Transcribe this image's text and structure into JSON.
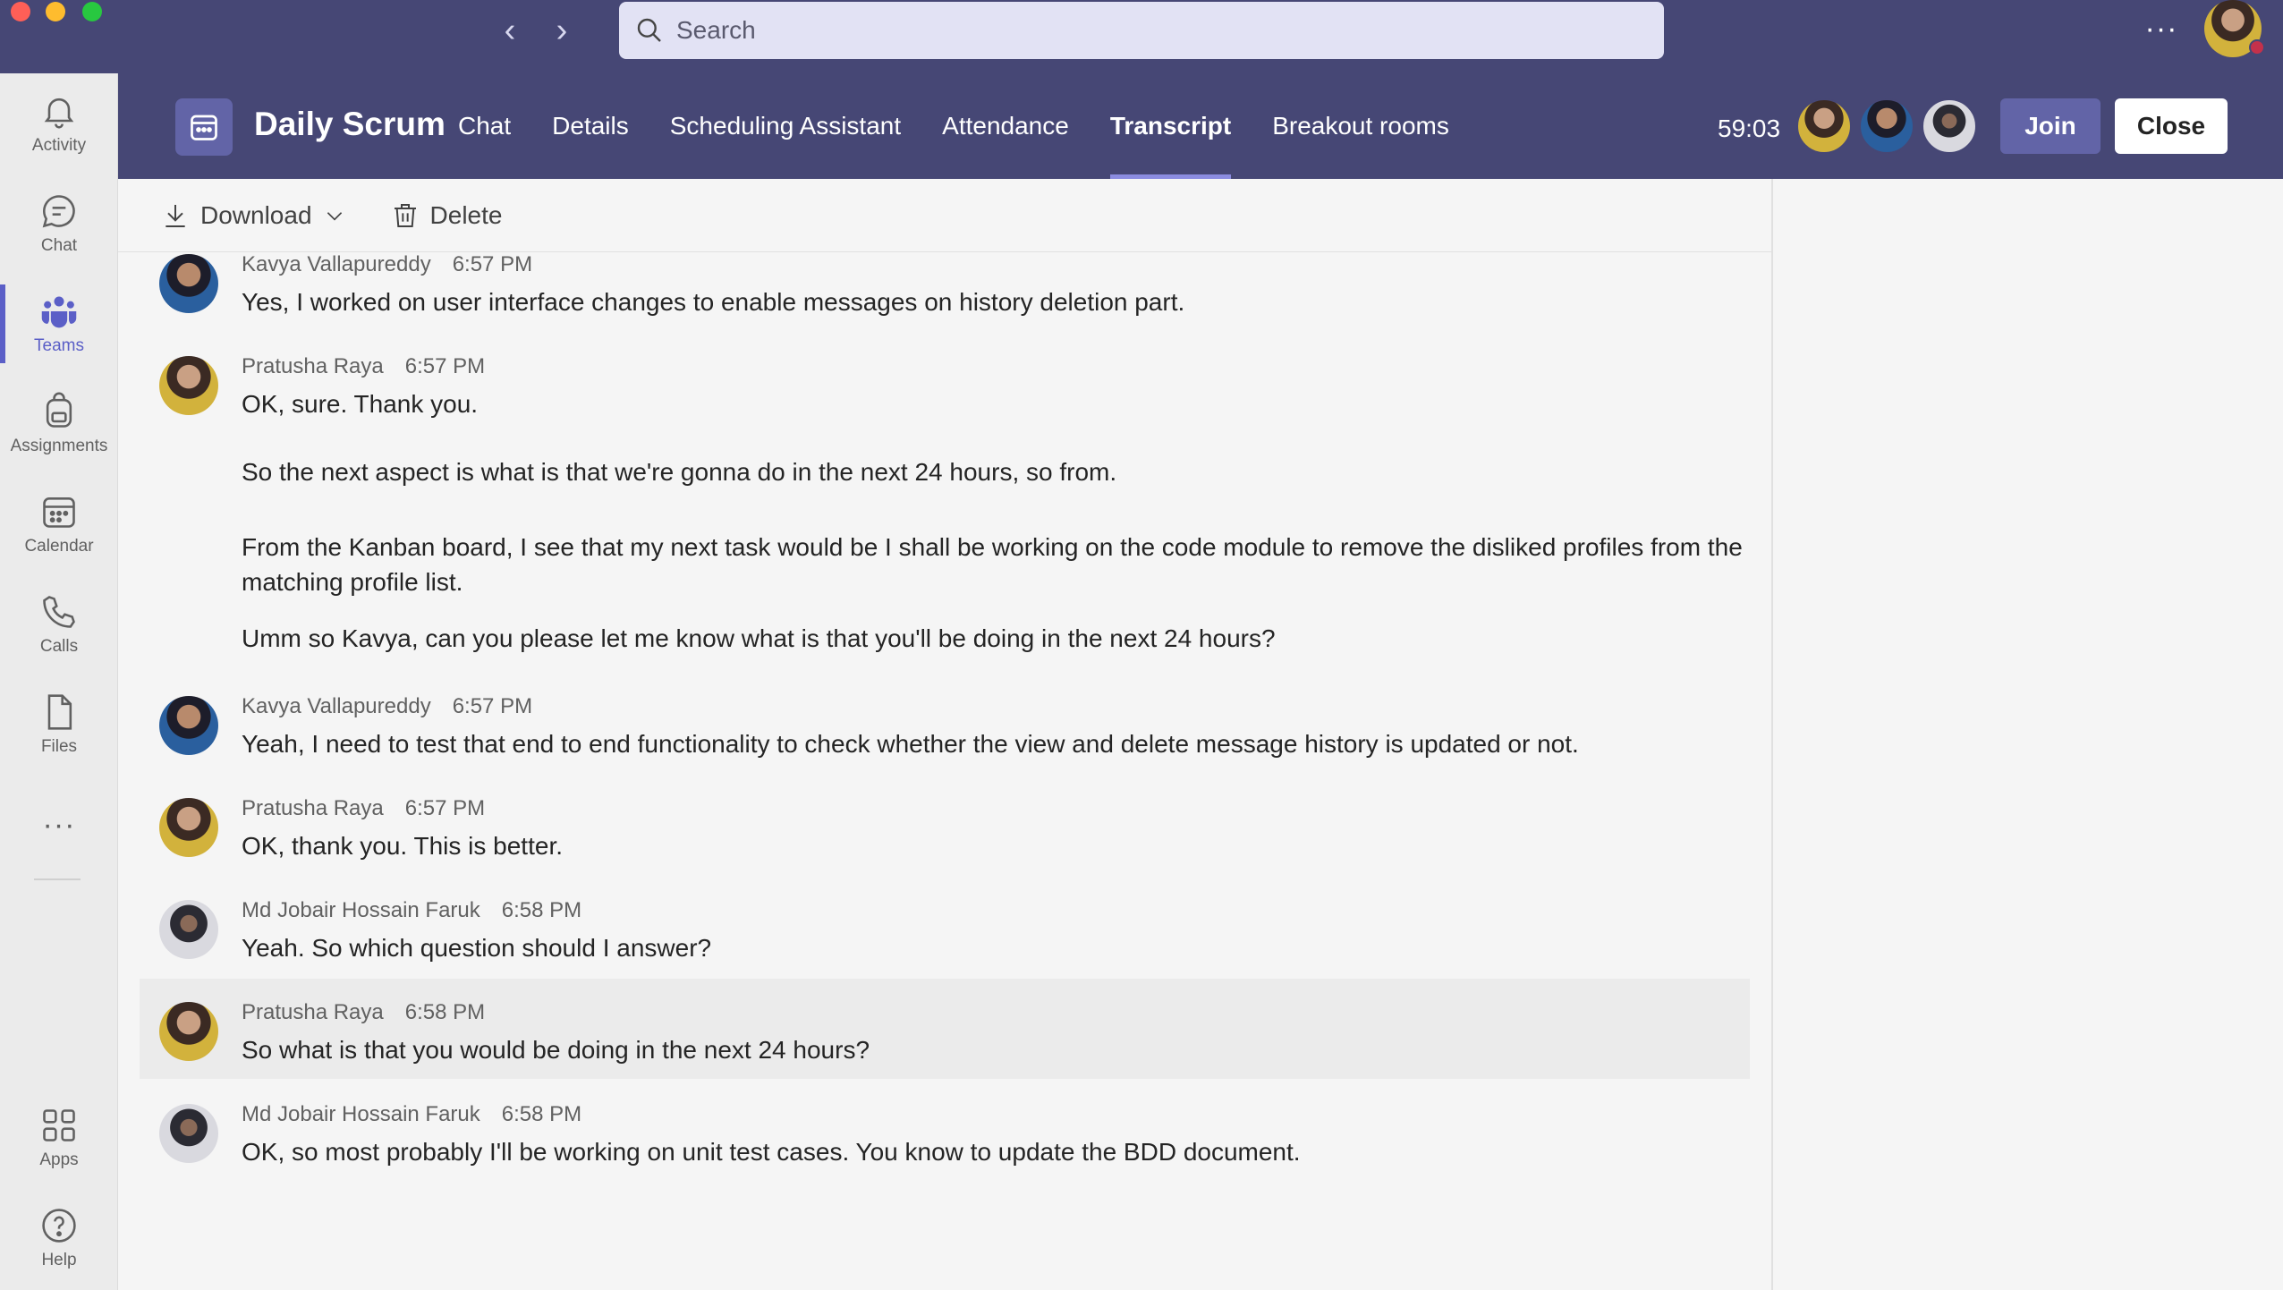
{
  "titlebar": {
    "search_placeholder": "Search",
    "back_symbol": "‹",
    "forward_symbol": "›",
    "more_symbol": "···"
  },
  "rail": {
    "items": [
      {
        "label": "Activity",
        "icon": "bell-icon"
      },
      {
        "label": "Chat",
        "icon": "chat-icon"
      },
      {
        "label": "Teams",
        "icon": "teams-icon",
        "active": true
      },
      {
        "label": "Assignments",
        "icon": "backpack-icon"
      },
      {
        "label": "Calendar",
        "icon": "calendar-icon"
      },
      {
        "label": "Calls",
        "icon": "phone-icon"
      },
      {
        "label": "Files",
        "icon": "file-icon"
      }
    ],
    "more_symbol": "···",
    "apps_label": "Apps",
    "help_label": "Help"
  },
  "meeting": {
    "title": "Daily Scrum",
    "tabs": [
      "Chat",
      "Details",
      "Scheduling Assistant",
      "Attendance",
      "Transcript",
      "Breakout rooms"
    ],
    "active_tab": "Transcript",
    "timer": "59:03",
    "join_label": "Join",
    "close_label": "Close",
    "accent_color": "#464775"
  },
  "toolbar": {
    "download_label": "Download",
    "delete_label": "Delete"
  },
  "transcript": [
    {
      "speaker": "Kavya Vallapureddy",
      "time": "6:57 PM",
      "lines": [
        "Yes, I worked on user interface changes to enable messages on history deletion part."
      ]
    },
    {
      "speaker": "Pratusha Raya",
      "time": "6:57 PM",
      "lines": [
        "OK, sure. Thank you.",
        "So the next aspect is what is that we're gonna do in the next 24 hours, so from.",
        "From the Kanban board, I see that my next task would be I shall be working on the code module to remove the disliked profiles from the matching profile list.",
        "Umm so Kavya, can you please let me know what is that you'll be doing in the next 24 hours?"
      ]
    },
    {
      "speaker": "Kavya Vallapureddy",
      "time": "6:57 PM",
      "lines": [
        "Yeah, I need to test that end to end functionality to check whether the view and delete message history is updated or not."
      ]
    },
    {
      "speaker": "Pratusha Raya",
      "time": "6:57 PM",
      "lines": [
        "OK, thank you. This is better."
      ]
    },
    {
      "speaker": "Md Jobair Hossain Faruk",
      "time": "6:58 PM",
      "lines": [
        "Yeah. So which question should I answer?"
      ]
    },
    {
      "speaker": "Pratusha Raya",
      "time": "6:58 PM",
      "lines": [
        "So what is that you would be doing in the next 24 hours?"
      ]
    },
    {
      "speaker": "Md Jobair Hossain Faruk",
      "time": "6:58 PM",
      "lines": [
        "OK, so most probably I'll be working on unit test cases. You know to update the BDD document."
      ]
    }
  ]
}
